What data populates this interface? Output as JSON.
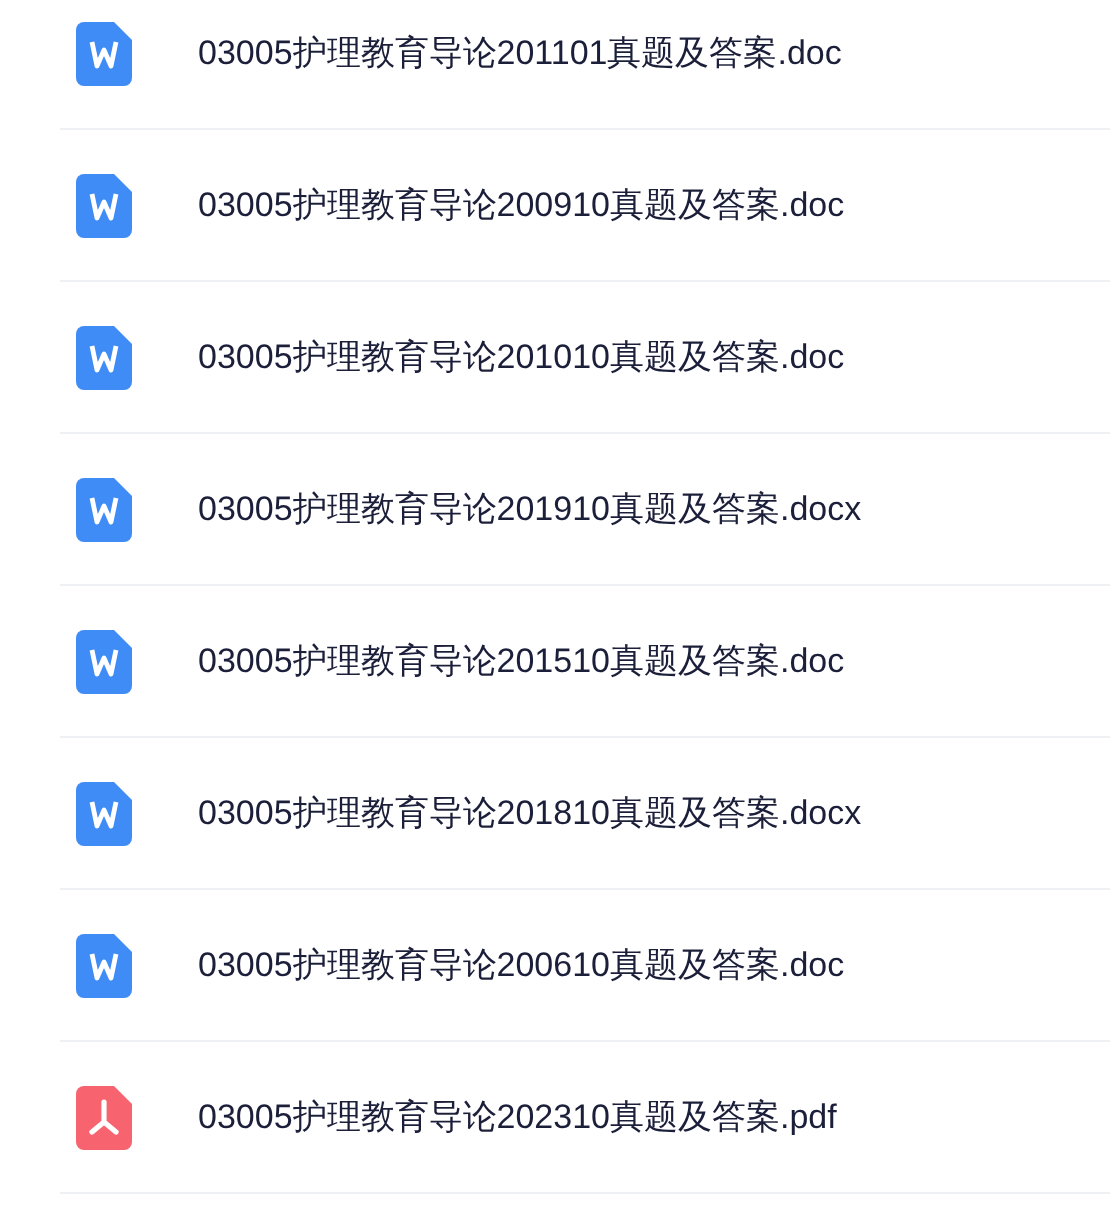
{
  "files": [
    {
      "kind": "word",
      "name": "03005护理教育导论201101真题及答案.doc"
    },
    {
      "kind": "word",
      "name": "03005护理教育导论200910真题及答案.doc"
    },
    {
      "kind": "word",
      "name": "03005护理教育导论201010真题及答案.doc"
    },
    {
      "kind": "word",
      "name": "03005护理教育导论201910真题及答案.docx"
    },
    {
      "kind": "word",
      "name": "03005护理教育导论201510真题及答案.doc"
    },
    {
      "kind": "word",
      "name": "03005护理教育导论201810真题及答案.docx"
    },
    {
      "kind": "word",
      "name": "03005护理教育导论200610真题及答案.doc"
    },
    {
      "kind": "pdf",
      "name": "03005护理教育导论202310真题及答案.pdf"
    }
  ]
}
